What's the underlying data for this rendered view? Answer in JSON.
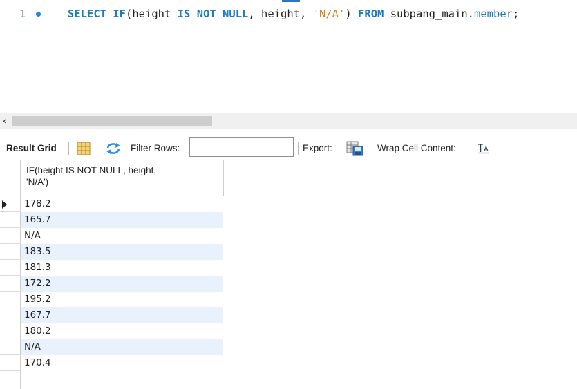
{
  "editor": {
    "line_number": "1",
    "sql": {
      "select": "SELECT",
      "if_open": "IF",
      "paren_open": "(height ",
      "is": "IS",
      "not": "NOT",
      "null": "NULL",
      "middle": ", height, ",
      "literal": "'N/A'",
      "paren_close": ") ",
      "from": "FROM",
      "schema": " subpang_main.",
      "table": "member",
      "semicolon": ";"
    }
  },
  "toolbar": {
    "result_grid_label": "Result Grid",
    "filter_rows_label": "Filter Rows:",
    "filter_rows_value": "",
    "export_label": "Export:",
    "wrap_cell_label": "Wrap Cell Content:",
    "icons": {
      "grid_view": "grid-view-icon",
      "refresh": "refresh-icon",
      "export": "export-icon",
      "wrap": "wrap-text-icon"
    }
  },
  "grid": {
    "column_header": "IF(height IS NOT NULL, height,\n'N/A')",
    "rows": [
      "178.2",
      "165.7",
      "N/A",
      "183.5",
      "181.3",
      "172.2",
      "195.2",
      "167.7",
      "180.2",
      "N/A",
      "170.4"
    ],
    "alt_row_color": "#e8f1fc"
  },
  "colors": {
    "keyword": "#1a7cbd",
    "string": "#d77e1a",
    "line_number": "#2d7fb6"
  }
}
